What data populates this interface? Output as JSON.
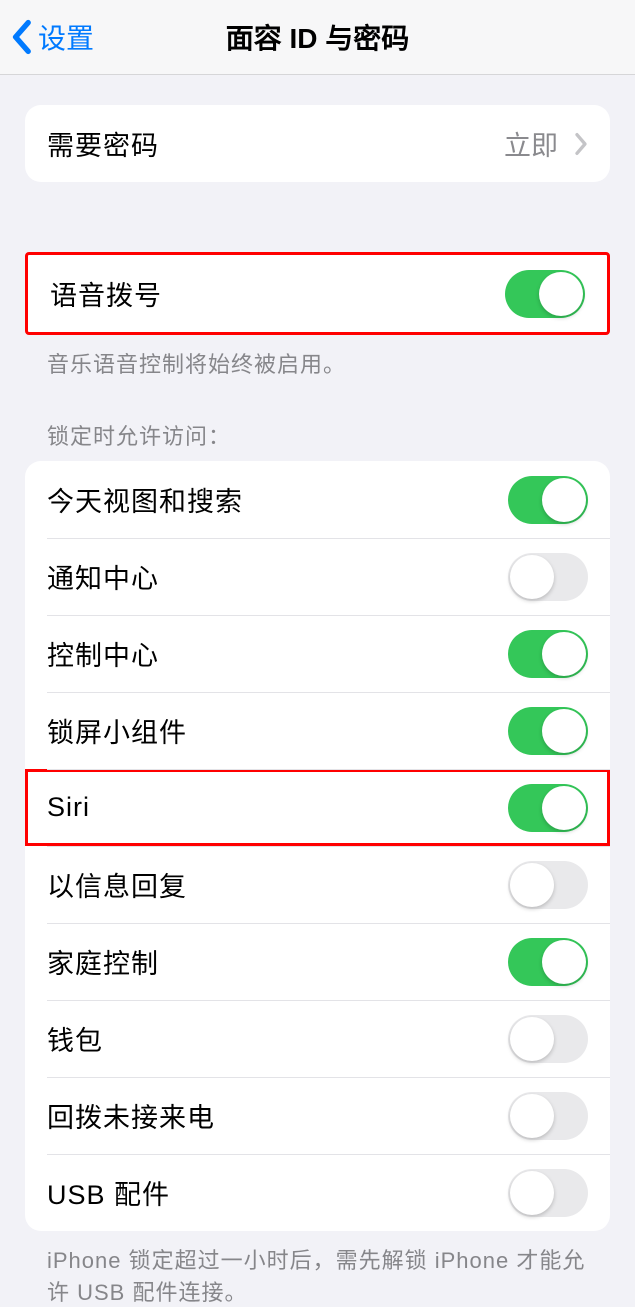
{
  "nav": {
    "back_label": "设置",
    "title": "面容 ID 与密码"
  },
  "passcode_row": {
    "label": "需要密码",
    "value": "立即"
  },
  "voice_dial": {
    "label": "语音拨号",
    "enabled": true,
    "footer": "音乐语音控制将始终被启用。"
  },
  "access_section": {
    "header": "锁定时允许访问：",
    "items": [
      {
        "label": "今天视图和搜索",
        "enabled": true,
        "highlighted": false
      },
      {
        "label": "通知中心",
        "enabled": false,
        "highlighted": false
      },
      {
        "label": "控制中心",
        "enabled": true,
        "highlighted": false
      },
      {
        "label": "锁屏小组件",
        "enabled": true,
        "highlighted": false
      },
      {
        "label": "Siri",
        "enabled": true,
        "highlighted": true
      },
      {
        "label": "以信息回复",
        "enabled": false,
        "highlighted": false
      },
      {
        "label": "家庭控制",
        "enabled": true,
        "highlighted": false
      },
      {
        "label": "钱包",
        "enabled": false,
        "highlighted": false
      },
      {
        "label": "回拨未接来电",
        "enabled": false,
        "highlighted": false
      },
      {
        "label": "USB 配件",
        "enabled": false,
        "highlighted": false
      }
    ],
    "footer": "iPhone 锁定超过一小时后，需先解锁 iPhone 才能允许 USB 配件连接。"
  }
}
